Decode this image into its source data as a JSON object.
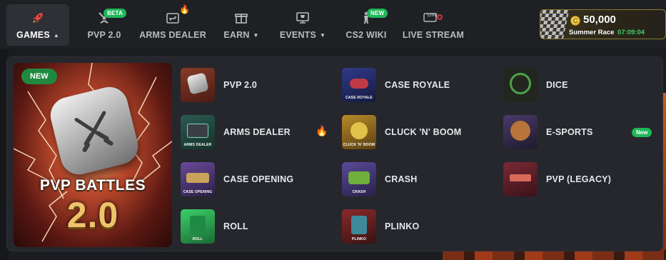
{
  "nav": {
    "items": [
      {
        "label": "GAMES",
        "icon": "rocket-icon",
        "active": true,
        "caret": "▲"
      },
      {
        "label": "PVP 2.0",
        "icon": "crossed-swords-icon",
        "badge": "BETA"
      },
      {
        "label": "ARMS DEALER",
        "icon": "gun-card-icon",
        "fire": "🔥"
      },
      {
        "label": "EARN",
        "icon": "gift-icon",
        "caret": "▼"
      },
      {
        "label": "EVENTS",
        "icon": "trophy-icon",
        "caret": "▼"
      },
      {
        "label": "CS2 WIKI",
        "icon": "soldier-icon",
        "badge": "NEW"
      },
      {
        "label": "LIVE STREAM",
        "icon": "live-tv-icon",
        "live": "LIVE"
      }
    ]
  },
  "race": {
    "coin_symbol": "C",
    "amount": "50,000",
    "name": "Summer Race",
    "timer": "07:09:04"
  },
  "hero": {
    "badge": "NEW",
    "title": "PVP BATTLES",
    "version": "2.0"
  },
  "games": [
    {
      "label": "PVP 2.0",
      "caption": "",
      "icon": "pvp-thumb"
    },
    {
      "label": "ARMS DEALER",
      "caption": "ARMS DEALER",
      "icon": "arms-dealer-thumb",
      "fire": "🔥"
    },
    {
      "label": "CASE OPENING",
      "caption": "CASE OPENING",
      "icon": "case-opening-thumb"
    },
    {
      "label": "ROLL",
      "caption": "ROLL",
      "icon": "roll-thumb"
    },
    {
      "label": "CASE ROYALE",
      "caption": "CASE ROYALE",
      "icon": "case-royale-thumb"
    },
    {
      "label": "CLUCK 'N' BOOM",
      "caption": "CLUCK 'N' BOOM",
      "icon": "cluck-n-boom-thumb"
    },
    {
      "label": "CRASH",
      "caption": "CRASH",
      "icon": "crash-thumb"
    },
    {
      "label": "PLINKO",
      "caption": "PLINKO",
      "icon": "plinko-thumb"
    },
    {
      "label": "DICE",
      "caption": "",
      "icon": "dice-thumb"
    },
    {
      "label": "E-SPORTS",
      "caption": "",
      "icon": "esports-thumb",
      "badge": "New"
    },
    {
      "label": "PVP (LEGACY)",
      "caption": "",
      "icon": "pvp-legacy-thumb"
    }
  ],
  "colors": {
    "accent_green": "#1fb75a",
    "timer_green": "#3fcf6a",
    "dropdown_bg": "#25272c",
    "page_bg": "#1b1c20"
  }
}
